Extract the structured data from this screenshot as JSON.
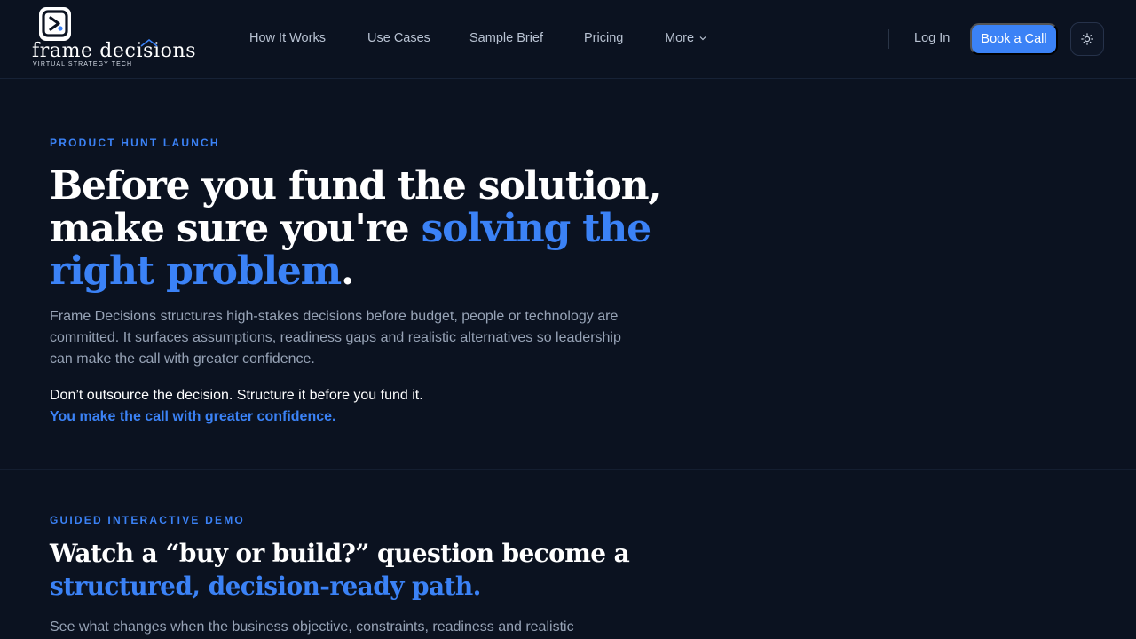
{
  "brand": {
    "name": "frame decisions",
    "tagline": "VIRTUAL STRATEGY TECH"
  },
  "nav": {
    "links": [
      "How It Works",
      "Use Cases",
      "Sample Brief",
      "Pricing"
    ],
    "more_label": "More",
    "login_label": "Log In",
    "cta_label": "Book a Call",
    "theme_icon": "sun-icon"
  },
  "hero": {
    "eyebrow": "PRODUCT HUNT LAUNCH",
    "title_part1": "Before you fund the solution, make sure you're ",
    "title_accent": "solving the right problem",
    "title_end": ".",
    "body": "Frame Decisions structures high-stakes decisions before budget, people or technology are committed. It surfaces assumptions, readiness gaps and realistic alternatives so leadership can make the call with greater confidence.",
    "strong_line": "Don’t outsource the decision. Structure it before you fund it.",
    "accent_line": "You make the call with greater confidence."
  },
  "demo": {
    "eyebrow": "GUIDED INTERACTIVE DEMO",
    "title_part1": "Watch a “buy or build?” question become a ",
    "title_accent": "structured, decision-ready path.",
    "body": "See what changes when the business objective, constraints, readiness and realistic"
  },
  "colors": {
    "background": "#0b1220",
    "accent": "#3b82f6",
    "muted_text": "#97a3b6"
  }
}
